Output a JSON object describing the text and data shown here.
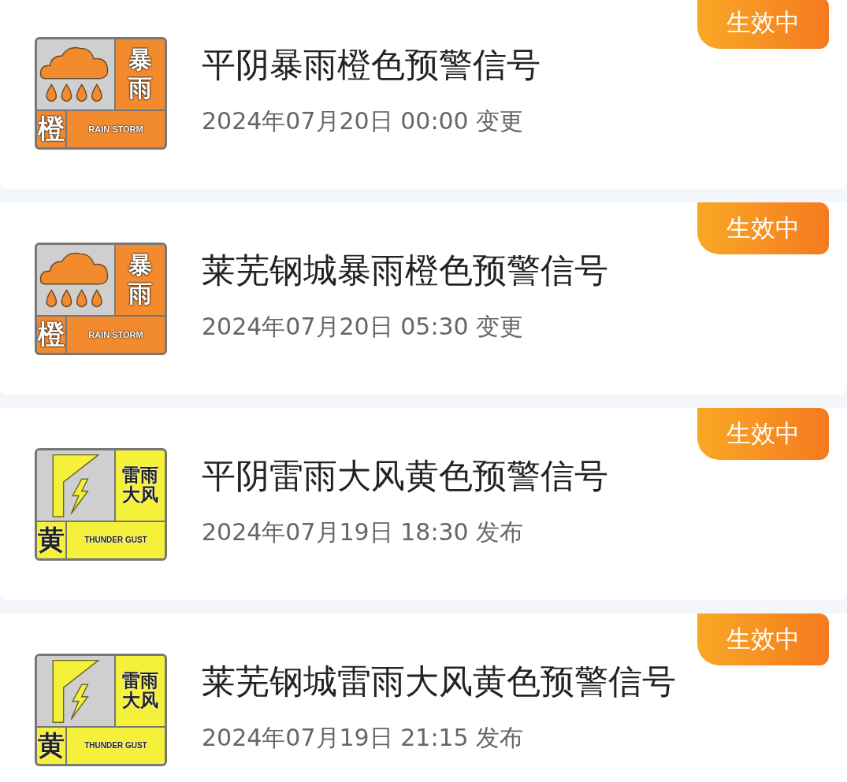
{
  "warnings": [
    {
      "status": "生效中",
      "title": "平阴暴雨橙色预警信号",
      "time": "2024年07月20日 00:00 变更",
      "sign": {
        "kind": "rainstorm",
        "color": "#f28a2e",
        "label_lines": [
          "暴",
          "雨"
        ],
        "level": "橙",
        "english": "RAIN STORM"
      }
    },
    {
      "status": "生效中",
      "title": "莱芜钢城暴雨橙色预警信号",
      "time": "2024年07月20日 05:30 变更",
      "sign": {
        "kind": "rainstorm",
        "color": "#f28a2e",
        "label_lines": [
          "暴",
          "雨"
        ],
        "level": "橙",
        "english": "RAIN STORM"
      }
    },
    {
      "status": "生效中",
      "title": "平阴雷雨大风黄色预警信号",
      "time": "2024年07月19日 18:30 发布",
      "sign": {
        "kind": "thunder",
        "color": "#f5f03a",
        "label_lines": [
          "雷雨",
          "大风"
        ],
        "level": "黄",
        "english": "THUNDER GUST"
      }
    },
    {
      "status": "生效中",
      "title": "莱芜钢城雷雨大风黄色预警信号",
      "time": "2024年07月19日 21:15 发布",
      "sign": {
        "kind": "thunder",
        "color": "#f5f03a",
        "label_lines": [
          "雷雨",
          "大风"
        ],
        "level": "黄",
        "english": "THUNDER GUST"
      }
    }
  ]
}
